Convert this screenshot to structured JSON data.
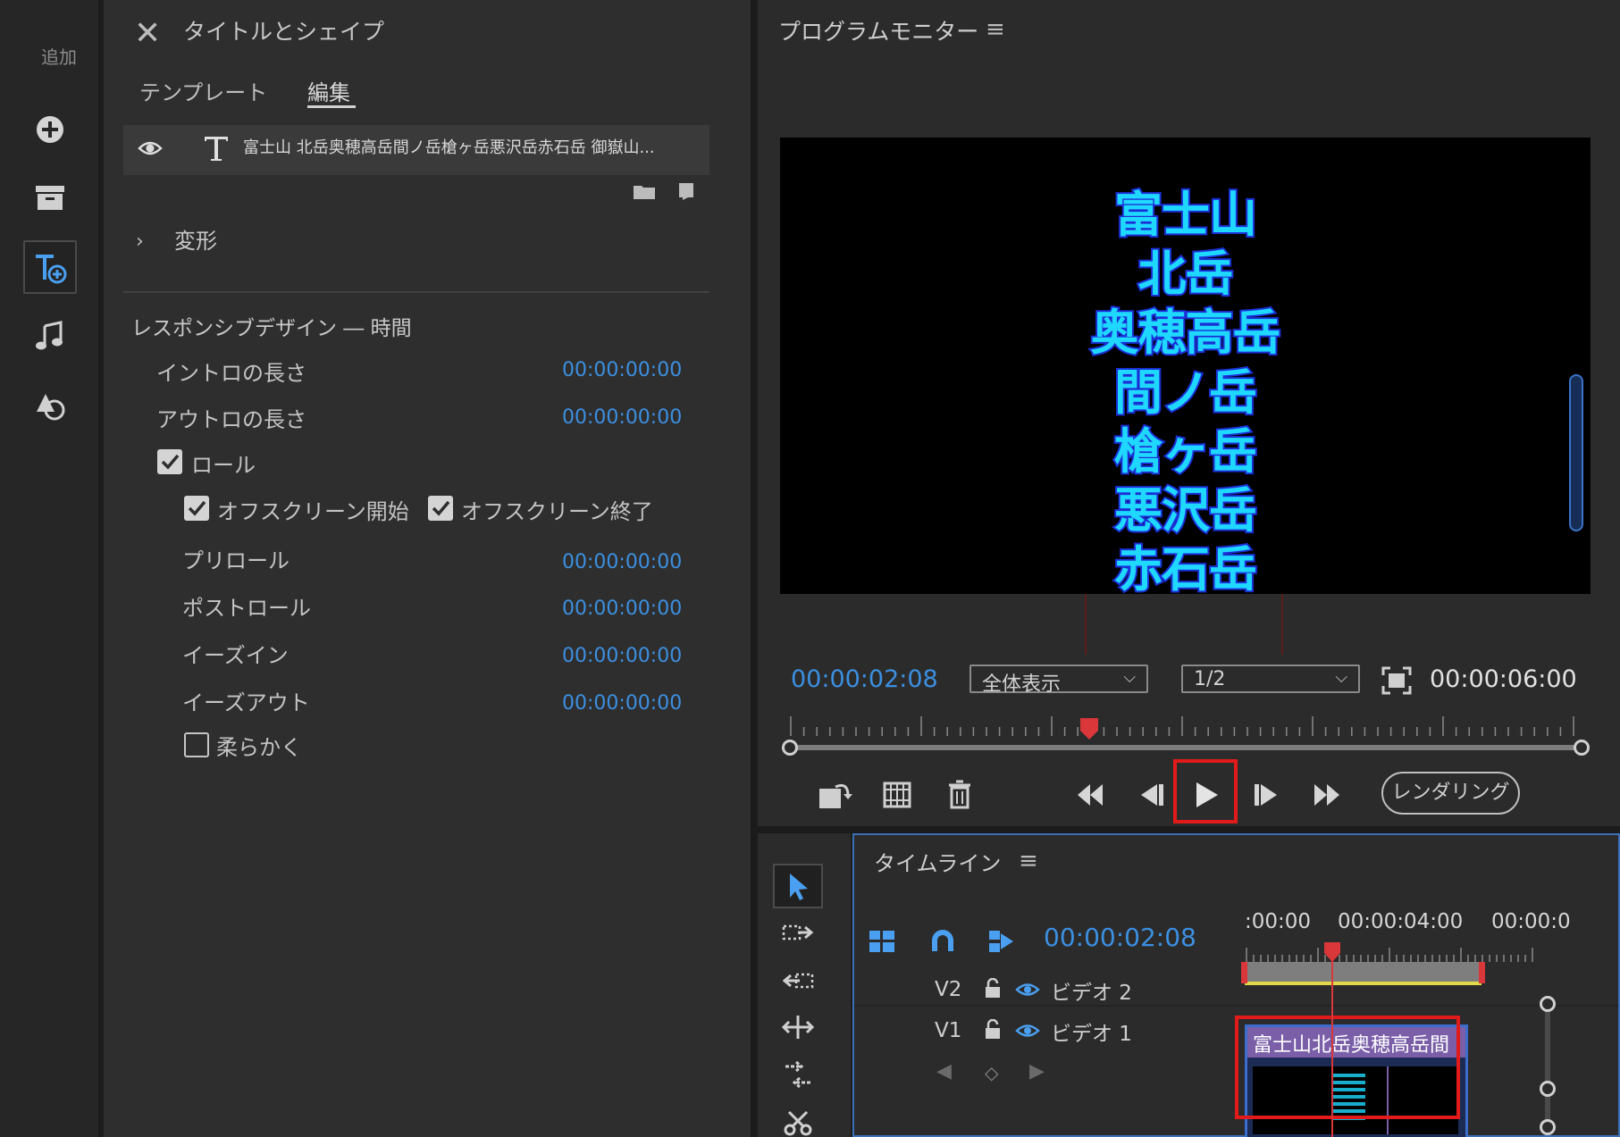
{
  "rail": {
    "label": "追加",
    "items": [
      "add-icon",
      "archive-icon",
      "text-add-icon",
      "music-note-icon",
      "shapes-icon"
    ]
  },
  "title_panel": {
    "title": "タイトルとシェイプ",
    "tabs": [
      "テンプレート",
      "編集"
    ],
    "active_tab": "編集",
    "layer_text": "富士山 北岳奥穂高岳間ノ岳槍ヶ岳悪沢岳赤石岳 御嶽山...",
    "transform_label": "変形",
    "responsive_heading": "レスポンシブデザイン ― 時間",
    "intro_label": "イントロの長さ",
    "intro_value": "00:00:00:00",
    "outro_label": "アウトロの長さ",
    "outro_value": "00:00:00:00",
    "roll_label": "ロール",
    "roll_checked": true,
    "offscreen_start_label": "オフスクリーン開始",
    "offscreen_start_checked": true,
    "offscreen_end_label": "オフスクリーン終了",
    "offscreen_end_checked": true,
    "preroll_label": "プリロール",
    "preroll_value": "00:00:00:00",
    "postroll_label": "ポストロール",
    "postroll_value": "00:00:00:00",
    "easein_label": "イーズイン",
    "easein_value": "00:00:00:00",
    "easeout_label": "イーズアウト",
    "easeout_value": "00:00:00:00",
    "smooth_label": "柔らかく",
    "smooth_checked": false
  },
  "monitor": {
    "title": "プログラムモニター",
    "menu_icon": "≡",
    "video_lines": [
      "富士山",
      "北岳",
      "奥穂高岳",
      "間ノ岳",
      "槍ヶ岳",
      "悪沢岳",
      "赤石岳"
    ],
    "current_time": "00:00:02:08",
    "zoom_select": "全体表示",
    "resolution_select": "1/2",
    "duration": "00:00:06:00",
    "render_label": "レンダリング",
    "playhead_fraction": 0.38
  },
  "timeline": {
    "title": "タイムライン",
    "menu_icon": "≡",
    "current_time": "00:00:02:08",
    "ruler_labels": [
      ":00:00",
      "00:00:04:00",
      "00:00:0"
    ],
    "tracks": [
      {
        "id": "V2",
        "name": "ビデオ 2"
      },
      {
        "id": "V1",
        "name": "ビデオ 1"
      }
    ],
    "clip_label": "富士山北岳奥穂高岳間"
  },
  "colors": {
    "accent": "#3c8fe0",
    "highlight_box": "#e11a1a",
    "title_fill": "#1fd8ff",
    "title_stroke": "#1b2fd6",
    "playhead": "#d9373a"
  }
}
